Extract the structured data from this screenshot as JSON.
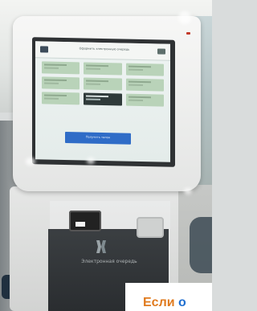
{
  "photo": {
    "kiosk": {
      "screen": {
        "header_title": "Оформить электронную очередь",
        "tiles": [
          {
            "label": "",
            "selected": false
          },
          {
            "label": "",
            "selected": false
          },
          {
            "label": "",
            "selected": false
          },
          {
            "label": "",
            "selected": false
          },
          {
            "label": "",
            "selected": false
          },
          {
            "label": "",
            "selected": false
          },
          {
            "label": "",
            "selected": false
          },
          {
            "label": "",
            "selected": true
          },
          {
            "label": "",
            "selected": false
          }
        ],
        "primary_button_label": "Получить талон",
        "accent_color": "#2f6cc7",
        "tile_color": "#b9d3b9"
      },
      "panel_caption": "Электронная очередь"
    },
    "overlay_caption": {
      "word1": "Если",
      "word2": "о",
      "word1_color": "#e07b1f",
      "word2_color": "#1f6fd0"
    }
  }
}
